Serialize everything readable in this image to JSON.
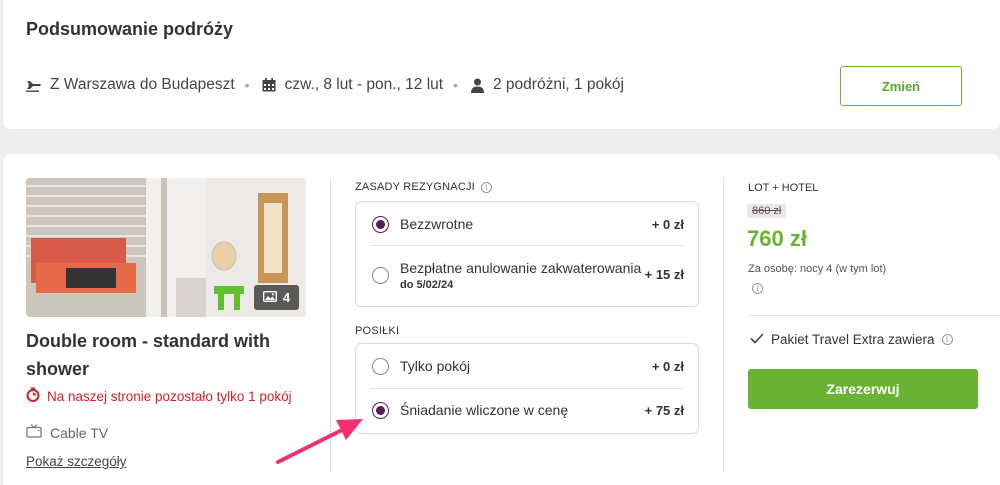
{
  "summary": {
    "title": "Podsumowanie podróży",
    "route": "Z Warszawa do Budapeszt",
    "dates": "czw., 8 lut - pon., 12 lut",
    "travelers": "2 podróżni, 1 pokój",
    "change_label": "Zmień"
  },
  "room": {
    "photo_count": "4",
    "title": "Double room - standard with shower",
    "scarcity": "Na naszej stronie pozostało tylko 1 pokój",
    "amenity": "Cable TV",
    "details_link": "Pokaż szczegóły"
  },
  "cancellation": {
    "label": "ZASADY REZYGNACJI",
    "options": [
      {
        "label": "Bezzwrotne",
        "sub": "",
        "price": "+ 0 zł",
        "selected": true
      },
      {
        "label": "Bezpłatne anulowanie zakwaterowania",
        "sub": "do 5/02/24",
        "price": "+ 15 zł",
        "selected": false
      }
    ]
  },
  "meals": {
    "label": "POSIŁKI",
    "options": [
      {
        "label": "Tylko pokój",
        "price": "+ 0 zł",
        "selected": false
      },
      {
        "label": "Śniadanie wliczone w cenę",
        "price": "+ 75 zł",
        "selected": true
      }
    ]
  },
  "pricing": {
    "type": "LOT + HOTEL",
    "old_price": "860 zł",
    "new_price": "760 zł",
    "per_person": "Za osobę: nocy 4 (w tym lot)",
    "package": "Pakiet Travel Extra zawiera",
    "book_label": "Zarezerwuj"
  },
  "colors": {
    "accent_green": "#6ab232",
    "radio_purple": "#5b1a57",
    "alert_red": "#d4202b",
    "annotation_arrow": "#f2306f"
  }
}
